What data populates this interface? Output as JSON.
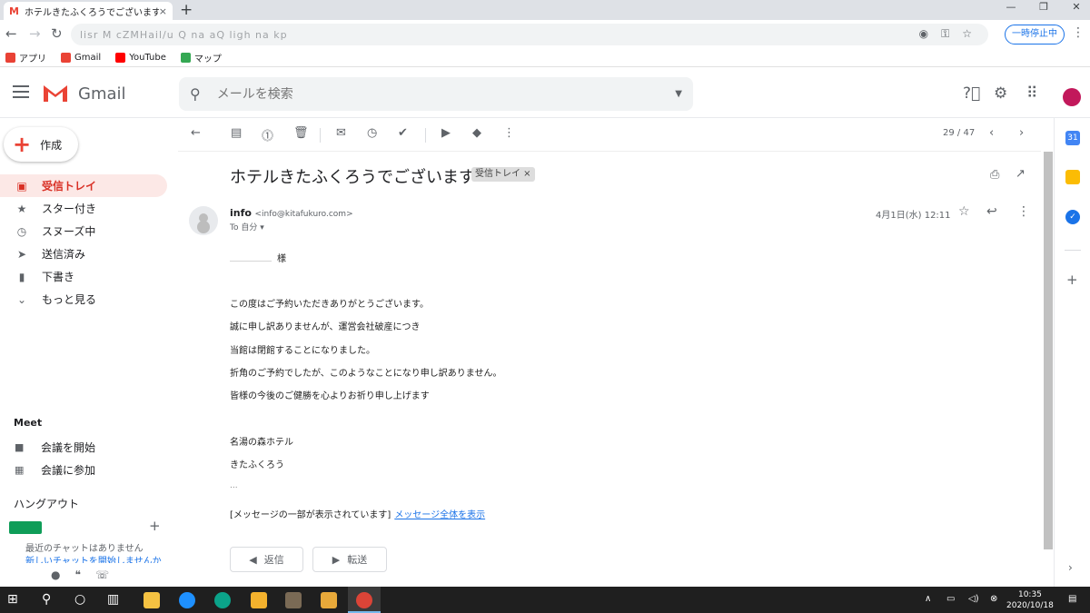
{
  "browser": {
    "tab_title": "ホテルきたふくろうでございます - koui",
    "tab_close": "×",
    "new_tab": "+",
    "win_min": "—",
    "win_max": "❐",
    "win_close": "✕",
    "url": "lisr  M  cZMHail/u  Q  na  aQ  ligh  na  kp",
    "pause_button": "一時停止中",
    "bookmarks": [
      {
        "label": "アプリ",
        "color": "#e94235"
      },
      {
        "label": "Gmail",
        "color": "#ea4335"
      },
      {
        "label": "YouTube",
        "color": "#ff0000"
      },
      {
        "label": "マップ",
        "color": "#34a853"
      }
    ]
  },
  "gmail": {
    "logo_text": "Gmail",
    "search_placeholder": "メールを検索",
    "compose_label": "作成",
    "nav": [
      {
        "label": "受信トレイ",
        "icon": "inbox-icon",
        "glyph": "▣",
        "active": true
      },
      {
        "label": "スター付き",
        "icon": "star-icon",
        "glyph": "★",
        "active": false
      },
      {
        "label": "スヌーズ中",
        "icon": "clock-icon",
        "glyph": "◷",
        "active": false
      },
      {
        "label": "送信済み",
        "icon": "send-icon",
        "glyph": "➤",
        "active": false
      },
      {
        "label": "下書き",
        "icon": "draft-icon",
        "glyph": "▮",
        "active": false
      },
      {
        "label": "もっと見る",
        "icon": "chevron-down-icon",
        "glyph": "⌄",
        "active": false
      }
    ],
    "meet": {
      "title": "Meet",
      "start": "会議を開始",
      "join": "会議に参加"
    },
    "hangouts": {
      "title": "ハングアウト",
      "no_chats": "最近のチャットはありません",
      "start_chat": "新しいチャットを開始しませんか"
    },
    "pager": "29 / 47",
    "message": {
      "subject": "ホテルきたふくろうでございます",
      "label": "受信トレイ ×",
      "sender_name": "info",
      "sender_email": "<info@kitafukuro.com>",
      "to": "To 自分 ▾",
      "date": "4月1日(水) 12:11",
      "greeting": "様",
      "lines": [
        "この度はご予約いただきありがとうございます。",
        "誠に申し訳ありませんが、運営会社破産につき",
        "当館は閉館することになりました。",
        "折角のご予約でしたが、このようなことになり申し訳ありません。",
        "皆様の今後のご健勝を心よりお祈り申し上げます"
      ],
      "signature": [
        "名湯の森ホテル",
        "きたふくろう"
      ],
      "ellipsis": "...",
      "clipped_note": "[メッセージの一部が表示されています]",
      "view_full": "メッセージ全体を表示"
    },
    "reply_label": "返信",
    "forward_label": "転送"
  },
  "taskbar": {
    "time": "10:35",
    "date": "2020/10/18"
  }
}
